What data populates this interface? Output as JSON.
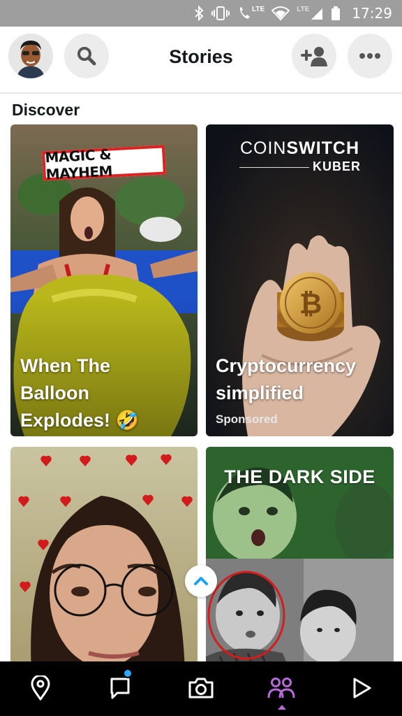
{
  "status_bar": {
    "time": "17:29",
    "network_label_1": "LTE",
    "network_label_2": "LTE"
  },
  "header": {
    "title": "Stories",
    "icons": [
      "avatar",
      "search-icon",
      "add-friend-icon",
      "more-icon"
    ]
  },
  "discover": {
    "section_title": "Discover",
    "cards": [
      {
        "brand": "MAGIC & MAYHEM",
        "headline_lines": [
          "When The",
          "Balloon",
          "Explodes! 🤣"
        ]
      },
      {
        "brand_regular": "COIN",
        "brand_bold": "SWITCH",
        "brand_sub": "KUBER",
        "headline_lines": [
          "Cryptocurrency",
          "simplified"
        ],
        "badge": "Sponsored"
      },
      {
        "headline_lines": []
      },
      {
        "brand": "THE DARK SIDE",
        "headline_lines": []
      }
    ]
  },
  "nav": {
    "items": [
      "map-icon",
      "chat-icon",
      "camera-icon",
      "stories-icon",
      "spotlight-icon"
    ],
    "active": "stories-icon",
    "accent_color": "#b36bd6",
    "chat_badge_color": "#2ea8ff"
  }
}
